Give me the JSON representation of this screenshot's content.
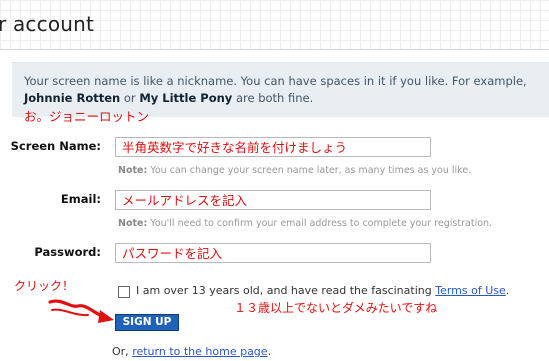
{
  "page_title": "r account",
  "info": {
    "text1": "Your screen name is like a nickname. You can have spaces in it if you like. For example,",
    "example1": "Johnnie Rotten",
    "or": "or",
    "example2": "My Little Pony",
    "text2": "are both fine."
  },
  "annotations": {
    "pony": "お。ジョニーロットン",
    "click": "クリック！",
    "age": "１３歳以上でないとダメみたいですね"
  },
  "form": {
    "screen_name": {
      "label": "Screen Name:",
      "value": "半角英数字で好きな名前を付けましょう",
      "note_label": "Note:",
      "note": "You can change your screen name later, as many times as you like."
    },
    "email": {
      "label": "Email:",
      "value": "メールアドレスを記入",
      "note_label": "Note:",
      "note": "You'll need to confirm your email address to complete your registration."
    },
    "password": {
      "label": "Password:",
      "value": "パスワードを記入"
    }
  },
  "terms": {
    "text": "I am over 13 years old, and have read the fascinating",
    "link": "Terms of Use",
    "end": "."
  },
  "signup_label": "SIGN UP",
  "footer": {
    "prefix": "Or,",
    "link": "return to the home page",
    "suffix": "."
  },
  "colors": {
    "annotation": "#e01010",
    "button": "#1e63b7",
    "link": "#2a57c4",
    "info_bg": "#e9eef3"
  }
}
